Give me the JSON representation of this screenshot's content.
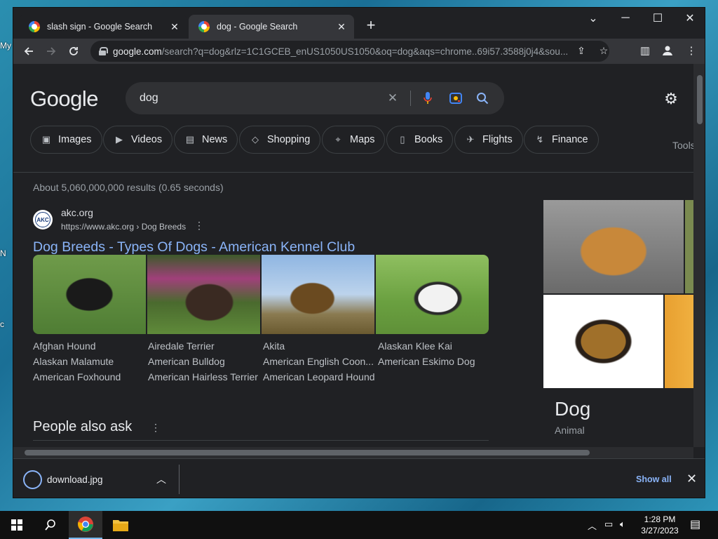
{
  "desktop": {
    "stubs": [
      "My",
      "N",
      "c"
    ]
  },
  "browser": {
    "tabs": [
      {
        "title": "slash sign - Google Search",
        "active": false
      },
      {
        "title": "dog - Google Search",
        "active": true
      }
    ],
    "new_tab": "+",
    "window_controls": {
      "tablist": "⌄",
      "minimize": "─",
      "maximize": "☐",
      "close": "✕"
    },
    "url_host": "google.com",
    "url_path": "/search?q=dog&rlz=1C1GCEB_enUS1050US1050&oq=dog&aqs=chrome..69i57.3588j0j4&sou..."
  },
  "search": {
    "logo": "Google",
    "query": "dog",
    "chips": [
      {
        "label": "Images",
        "icon": "image-icon"
      },
      {
        "label": "Videos",
        "icon": "video-icon"
      },
      {
        "label": "News",
        "icon": "news-icon"
      },
      {
        "label": "Shopping",
        "icon": "tag-icon"
      },
      {
        "label": "Maps",
        "icon": "map-pin-icon"
      },
      {
        "label": "Books",
        "icon": "book-icon"
      },
      {
        "label": "Flights",
        "icon": "plane-icon"
      },
      {
        "label": "Finance",
        "icon": "chart-icon"
      }
    ],
    "tools": "Tools",
    "stats": "About 5,060,000,000 results (0.65 seconds)"
  },
  "result": {
    "site_name": "akc.org",
    "favicon_text": "AKC",
    "cite": "https://www.akc.org › Dog Breeds",
    "title": "Dog Breeds - Types Of Dogs - American Kennel Club",
    "breeds": [
      [
        "Afghan Hound",
        "Alaskan Malamute",
        "American Foxhound"
      ],
      [
        "Airedale Terrier",
        "American Bulldog",
        "American Hairless Terrier"
      ],
      [
        "Akita",
        "American English Coon...",
        "American Leopard Hound"
      ],
      [
        "Alaskan Klee Kai",
        "American Eskimo Dog"
      ]
    ]
  },
  "paa": {
    "title": "People also ask"
  },
  "knowledge_panel": {
    "title": "Dog",
    "subtitle": "Animal"
  },
  "download": {
    "filename": "download.jpg",
    "show_all": "Show all"
  },
  "taskbar": {
    "time": "1:28 PM",
    "date": "3/27/2023"
  }
}
